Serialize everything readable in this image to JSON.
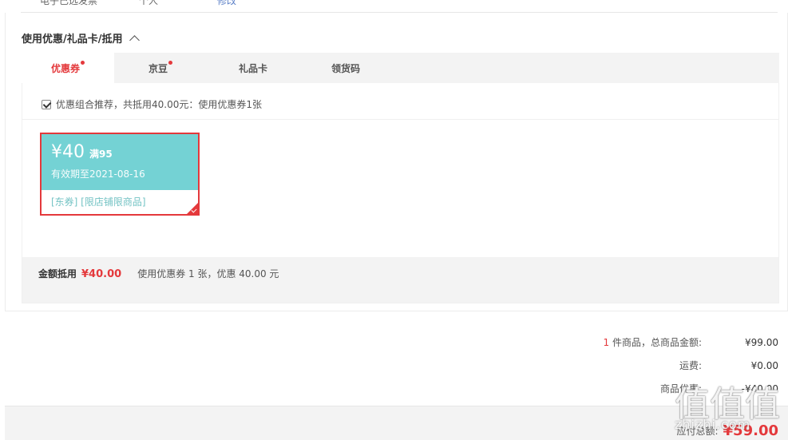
{
  "top_strip": {
    "text_a": "电子已选发票",
    "text_b": "个人",
    "text_c": "修改"
  },
  "section": {
    "title": "使用优惠/礼品卡/抵用"
  },
  "tabs": [
    {
      "label": "优惠券",
      "active": true,
      "badge": true
    },
    {
      "label": "京豆",
      "active": false,
      "badge": true
    },
    {
      "label": "礼品卡",
      "active": false,
      "badge": false
    },
    {
      "label": "领货码",
      "active": false,
      "badge": false
    }
  ],
  "combo": {
    "text": "优惠组合推荐，共抵用40.00元：使用优惠券1张",
    "checked": true
  },
  "coupon": {
    "amount": "¥40",
    "condition": "满95",
    "validity": "有效期至2021-08-16",
    "tags": "[东券] [限店铺限商品]",
    "selected": true
  },
  "summary": {
    "label": "金额抵用",
    "amount": "¥40.00",
    "desc": "使用优惠券 1 张，优惠 40.00 元"
  },
  "totals": {
    "items_count": "1",
    "items_label": " 件商品，总商品金额:",
    "items_value": "¥99.00",
    "shipping_label": "运费:",
    "shipping_value": "¥0.00",
    "discount_label": "商品优惠:",
    "discount_value": "-¥40.00"
  },
  "pay": {
    "label": "应付总额:",
    "value": "¥59.00"
  },
  "watermark": {
    "glyphs": "值值值",
    "url": "zhizhi.com"
  },
  "colors": {
    "accent": "#e4393c",
    "coupon_bg": "#74d2d4",
    "tab_bg": "#f3f3f3"
  }
}
